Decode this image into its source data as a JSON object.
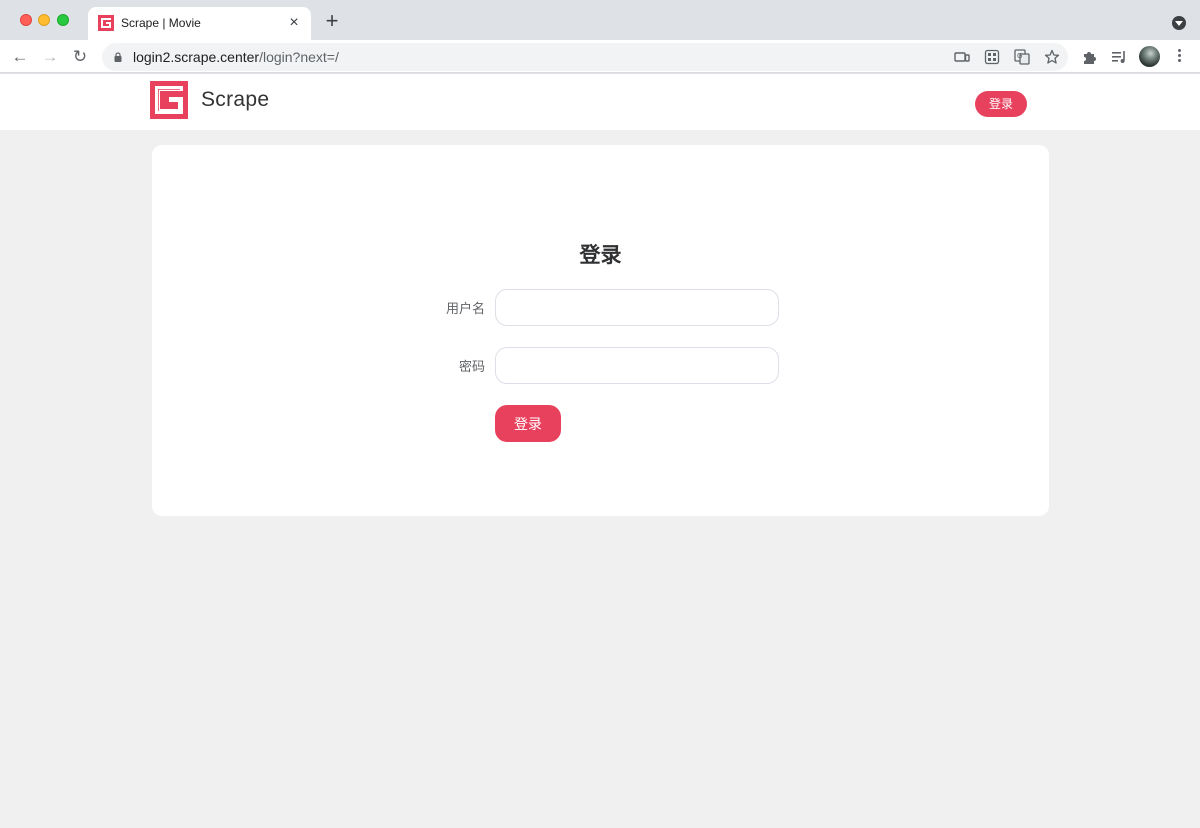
{
  "browser": {
    "tab": {
      "title": "Scrape | Movie",
      "close_icon": "×",
      "favicon": "scrape-logo-icon"
    },
    "new_tab_label": "+",
    "nav": {
      "back": "←",
      "forward": "→",
      "reload": "↻"
    },
    "address": {
      "host": "login2.scrape.center",
      "path": "/login?next=/"
    },
    "icons": [
      "cast-icon",
      "qr-code-icon",
      "translate-icon",
      "star-icon",
      "extensions-icon",
      "media-control-icon",
      "profile-avatar",
      "menu-icon"
    ]
  },
  "site": {
    "name": "Scrape",
    "brand_color": "#e8415e",
    "header_login_label": "登录"
  },
  "login_form": {
    "title": "登录",
    "username": {
      "label": "用户名",
      "value": "",
      "placeholder": ""
    },
    "password": {
      "label": "密码",
      "value": "",
      "placeholder": ""
    },
    "submit_label": "登录"
  }
}
